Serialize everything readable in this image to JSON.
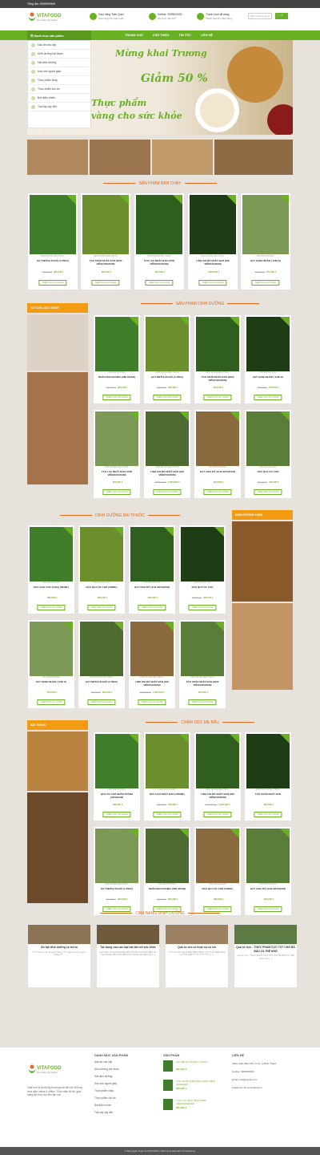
{
  "topbar": {
    "phone": "Tổng đài: 0999999999"
  },
  "header": {
    "brand": "VITAFOOD",
    "tagline": "thực phẩm dinh dưỡng",
    "ship_title": "Giao hàng Toàn Quốc",
    "ship_sub": "Giao hàng trên toàn quốc",
    "hotline_title": "Hotline: 0999000000",
    "hotline_sub": "Hỗ trợ tư vấn 24/7",
    "pay_title": "Thanh toán dễ dàng",
    "pay_sub": "Thanh toán khi nhận hàng",
    "search_placeholder": "Bạn muốn mua gì ?",
    "cart_count": "0"
  },
  "nav": {
    "category_button": "Danh mục sản phẩm",
    "items": [
      "TRANG CHỦ",
      "GIỚI THIỆU",
      "TIN TỨC",
      "LIÊN HỆ"
    ]
  },
  "categories": [
    "Dầu ăn cao cấp",
    "Dinh dưỡng bài thuốc",
    "Hạt dinh dưỡng",
    "Hoa chè người giấy",
    "Thực phẩm chay",
    "Thực phẩm cho bé",
    "Bột thiên nhiên",
    "Trái cây sấy dẻo"
  ],
  "banner": {
    "line1": "Mừng khai Trương",
    "line2": "Giảm 50 %",
    "line3": "Thực phẩm",
    "line4": "vàng cho sức khỏe"
  },
  "colors": {
    "brand": "#6ab023",
    "accent": "#e86a1c",
    "side": "#f39c12"
  },
  "sections": {
    "best": "SẢN PHẨM BÁN CHẠY",
    "nutrition": "SẢN PHẨM DINH DƯỠNG",
    "side1": "TỐT CHO SỨC KHỎE",
    "remedy": "DINH DƯỠNG BÀI THUỐC",
    "side2": "DINH DƯỠNG VÀNG",
    "mom": "CHĂM SÓC MẸ BẦU",
    "side3": "BÀI THUỐC",
    "handbook": "CẨM NANG DINH DƯỠNG"
  },
  "btn_add": "THÊM VÀO GIỎ HÀNG",
  "best_products": [
    {
      "cat": "DINH DƯỠNG BÀI THUỐC",
      "name": "HẠT METHI ẤN ĐỘ (1.25KG)",
      "old": "320.000 ₫",
      "price": "260.000 ₫"
    },
    {
      "cat": "DINH DƯỠNG BÀI THUỐC",
      "name": "TẢO XOẮN NHẬT BẢN (2200 VIÊN/440GRAM)",
      "old": "",
      "price": "650.000 ₫"
    },
    {
      "cat": "DINH DƯỠNG BÀI THUỐC",
      "name": "TẢO LỤC NHẬT BẢN (1550 VIÊN/310GRAM)",
      "old": "",
      "price": "650.000 ₫"
    },
    {
      "cat": "DINH DƯỠNG BÀI THUỐC",
      "name": "LINH CHI ĐỎ NHẬT BẢN (180 VIÊN/54GRAM)",
      "old": "",
      "price": "1.805.000 ₫"
    },
    {
      "cat": "HẠT DINH DƯỠNG",
      "name": "HẠT HẠNH NHÂN ( 1160 G)",
      "old": "720.000 ₫",
      "price": "670.000 ₫"
    }
  ],
  "nutrition_products": [
    {
      "cat": "HẠT DINH DƯỠNG",
      "name": "NHÂN MACADAMIA (680 GRAM)",
      "old": "420.000 ₫",
      "price": "280.000 ₫"
    },
    {
      "cat": "DINH DƯỠNG BÀI THUỐC",
      "name": "HẠT METHI ẤN ĐỘ (1.25KG)",
      "old": "320.000 ₫",
      "price": "260.000 ₫"
    },
    {
      "cat": "DINH DƯỠNG BÀI THUỐC",
      "name": "TẢO XOẮN NHẬT BẢN (2200 VIÊN/440GRAM)",
      "old": "",
      "price": "650.000 ₫"
    },
    {
      "cat": "HẠT DINH DƯỠNG",
      "name": "HẠT HẠNH NHÂN ( 1160 G)",
      "old": "720.000 ₫",
      "price": "670.000 ₫"
    },
    {
      "cat": "DINH DƯỠNG BÀI THUỐC",
      "name": "TẢO LỤC NHẬT BẢN (1550 VIÊN/310GRAM)",
      "old": "",
      "price": "650.000 ₫"
    },
    {
      "cat": "DINH DƯỠNG BÀI THUỐC",
      "name": "LINH CHI ĐỎ NHẬT BẢN (180 VIÊN/54GRAM)",
      "old": "1.900.000 ₫",
      "price": "1.805.000 ₫"
    },
    {
      "cat": "HẠT DINH DƯỠNG",
      "name": "HẠT CHIA MỸ (2LB=907GRAM)",
      "old": "",
      "price": "290.000 ₫"
    },
    {
      "cat": "DẦU ĂN CAO CẤP",
      "name": "DẦU QUẢ ÓC CHÓ",
      "old": "490.000 ₫",
      "price": "433.000 ₫"
    }
  ],
  "remedy_products": [
    {
      "cat": "DẦU ĂN CAO CẤP",
      "name": "DẦU CHIA CỎC (CHIA) (500ML)",
      "old": "",
      "price": "580.000 ₫"
    },
    {
      "cat": "DẦU ĂN CAO CẤP",
      "name": "DẦU QUẢ ÓC CHÓ (500ML)",
      "old": "",
      "price": "580.000 ₫"
    },
    {
      "cat": "HẠT DINH DƯỠNG",
      "name": "HẠT CHIA MỸ (2LB=907GRAM)",
      "old": "",
      "price": "290.000 ₫"
    },
    {
      "cat": "DẦU ĂN CAO CẤP",
      "name": "DẦU QUẢ ÓC CHÓ",
      "old": "490.000 ₫",
      "price": "433.000 ₫"
    },
    {
      "cat": "HẠT DINH DƯỠNG",
      "name": "HẠT HẠNH NHÂN ( 1160 G)",
      "old": "",
      "price": "670.000 ₫"
    },
    {
      "cat": "DINH DƯỠNG BÀI THUỐC",
      "name": "HẠT METHI ẤN ĐỘ (1.25KG)",
      "old": "320.000 ₫",
      "price": "260.000 ₫"
    },
    {
      "cat": "DINH DƯỠNG BÀI THUỐC",
      "name": "LINH CHI ĐỎ NHẬT BẢN (180 VIÊN/54GRAM)",
      "old": "1.900.000 ₫",
      "price": "1.805.000 ₫"
    },
    {
      "cat": "DINH DƯỠNG BÀI THUỐC",
      "name": "TẢO XOẮN NHẬT BẢN (2200 VIÊN/440GRAM)",
      "old": "",
      "price": "650.000 ₫"
    }
  ],
  "mom_products": [
    {
      "cat": "HẠT DINH DƯỠNG",
      "name": "QUẢ ÓC CHÓ NHÂN TRẮNG (400GRAM)",
      "old": "",
      "price": "490.000 ₫"
    },
    {
      "cat": "DẦU ĂN CAO CẤP",
      "name": "DẦU GẠO NHẬT BẢN (1500ML)",
      "old": "230.000 ₫",
      "price": "180.000 ₫"
    },
    {
      "cat": "DINH DƯỠNG BÀI THUỐC",
      "name": "LINH CHI ĐỎ NHẬT BẢN (180 VIÊN/54GRAM)",
      "old": "1.900.000 ₫",
      "price": "1.805.000 ₫"
    },
    {
      "cat": "DINH DƯỠNG BÀI THUỐC",
      "name": "TẢO XOẮN NHẬT BẢN",
      "old": "",
      "price": "650.000 ₫"
    },
    {
      "cat": "DINH DƯỠNG BÀI THUỐC",
      "name": "HẠT METHI ẤN ĐỘ (1.25KG)",
      "old": "320.000 ₫",
      "price": "260.000 ₫"
    },
    {
      "cat": "HẠT DINH DƯỠNG",
      "name": "NHÂN MACADAMIA (680 GRAM)",
      "old": "420.000 ₫",
      "price": "280.000 ₫"
    },
    {
      "cat": "DẦU ĂN CAO CẤP",
      "name": "DẦU QUẢ ÓC CHÓ (500ML)",
      "old": "",
      "price": "580.000 ₫"
    },
    {
      "cat": "HẠT DINH DƯỠNG",
      "name": "HẠT CHIA MỸ (2LB=907GRAM)",
      "old": "",
      "price": "290.000 ₫"
    }
  ],
  "news": [
    {
      "title": "Ăn hạt dinh dưỡng có tốt ko",
      "excerpt": "???? Hạt óc chó ăn ngon không ???? Hạt óc chó có ngon không ??..."
    },
    {
      "title": "Tác dụng của các loại hạt đối với sức khỏe",
      "excerpt": "HẠT MẮC CA THƠM NGON BỔ DƯỠNG HẠT ĐẶC BIỆT CÓ TÁC DỤNG RẤT LỚN ĐẾN SỨC KHỎE CỦA BẠN VÀ [...]"
    },
    {
      "title": "Quả óc chó có thực sự có ích",
      "excerpt": "???? TÁO ĐỎ NHẬT BẢN NÊN UỐNG VÀO THỜI ĐIỂM NÀO LÀ TỐT NHẤT ???? ?? ?? ?? ?? [...]"
    },
    {
      "title": "Quả óc chó – THỰC PHẨM CỰC TỐT CHO BÀ BẦU VÀ TRẺ NHỎ",
      "excerpt": "Quả óc chó – THỰC PHẨM CỰC TỐT CHO BÀ BẦU VÀ TRẺ NHỎ Quả [...]"
    }
  ],
  "footer": {
    "about": "VitaFood là hệ thống thương mại điện tử kết hợp mua sắm online & offline. Thỏa mãn đồ ăn, giao hàng tận nhà, thu tiền tận nơi.",
    "col_cat": "DANH MỤC SẢN PHẨM",
    "col_prod": "SẢN PHẨM",
    "col_contact": "LIÊN HỆ",
    "cats": [
      "Dầu ăn cao cấp",
      "Dinh dưỡng bài thuốc",
      "Hạt dinh dưỡng",
      "Hoa chè người giấy",
      "Thực phẩm chay",
      "Thực phẩm cho bé",
      "Bột thiên nhiên",
      "Trái cây sấy dẻo"
    ],
    "prods": [
      {
        "name": "HẠT METHI ẤN ĐỘ (1.25KG)",
        "price": "260.000 ₫"
      },
      {
        "name": "TẢO XOẮN NHẬT BẢN (2200 VIÊN/ 440GRAM)",
        "price": "650.000 ₫"
      },
      {
        "name": "TẢO LỤC NHẬT BẢN (1550 VIÊN/310GRAM)",
        "price": "650.000 ₫"
      }
    ],
    "contact": [
      "448A, Điện Biên Phủ, P.21, Q.Bình Thạnh",
      "Hotline: 0999000000",
      "Email: mail@gmail.com",
      "Facebook: fb.com/webdemo"
    ]
  },
  "copyright": "© Bản quyền thuộc về VITAFOOD | Thiết kế và phát triển bởi webdemo"
}
